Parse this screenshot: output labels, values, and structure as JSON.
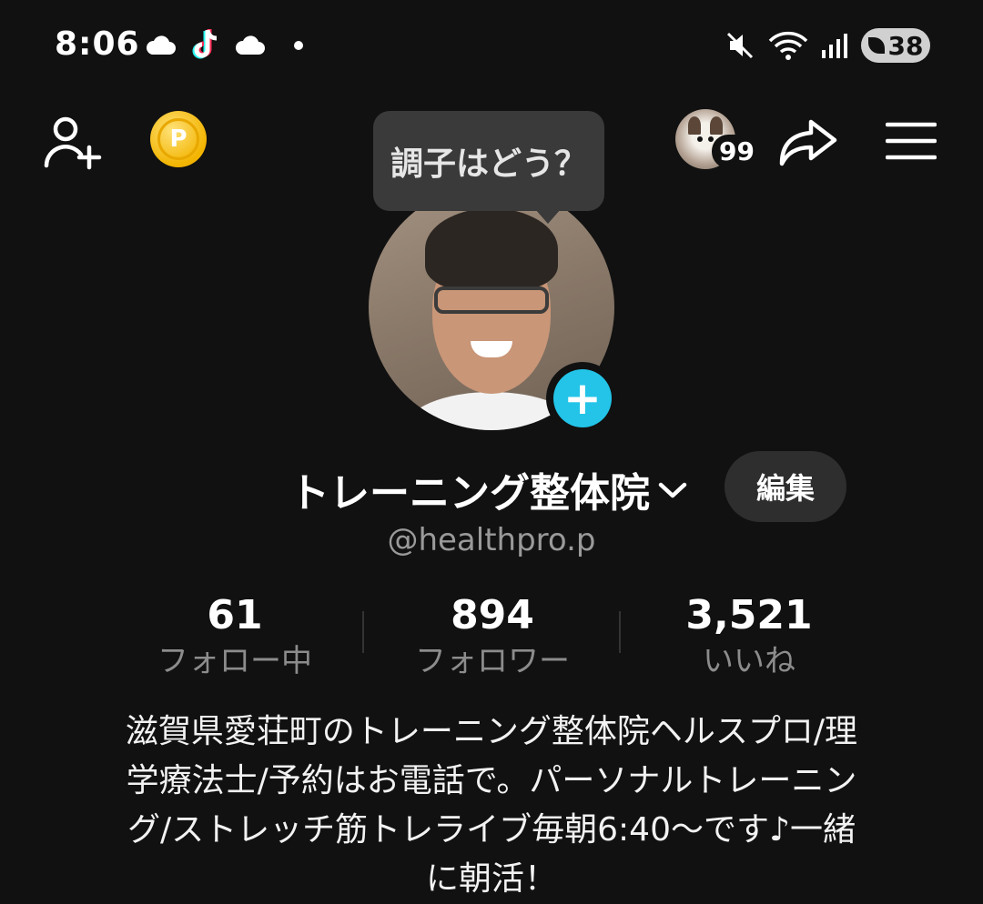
{
  "status_bar": {
    "time": "8:06",
    "battery": "38",
    "icons": [
      "cloud-icon",
      "tiktok-icon",
      "cloud-icon",
      "dot-icon",
      "mute-icon",
      "wifi-icon",
      "signal-icon",
      "battery-icon"
    ]
  },
  "top_bar": {
    "tooltip": "調子はどう？",
    "friends_count": "99",
    "icons": [
      "add-friend-icon",
      "coin-icon",
      "share-icon",
      "menu-icon"
    ]
  },
  "profile": {
    "display_name": "トレーニング整体院",
    "edit_label": "編集",
    "username": "@healthpro.p"
  },
  "stats": {
    "following": {
      "value": "61",
      "label": "フォロー中"
    },
    "followers": {
      "value": "894",
      "label": "フォロワー"
    },
    "likes": {
      "value": "3,521",
      "label": "いいね"
    }
  },
  "bio": {
    "line1": "滋賀県愛荘町のトレーニング整体院ヘルスプロ/理",
    "line2": "学療法士/予約はお電話で。パーソナルトレーニン",
    "line3": "グ/ストレッチ筋トレライブ毎朝6:40〜です♪一緒",
    "line4": "に朝活！"
  },
  "colors": {
    "background": "#111111",
    "accent_add": "#23c4e8",
    "coin": "#f2b400",
    "muted_text": "#8c8c8c"
  }
}
